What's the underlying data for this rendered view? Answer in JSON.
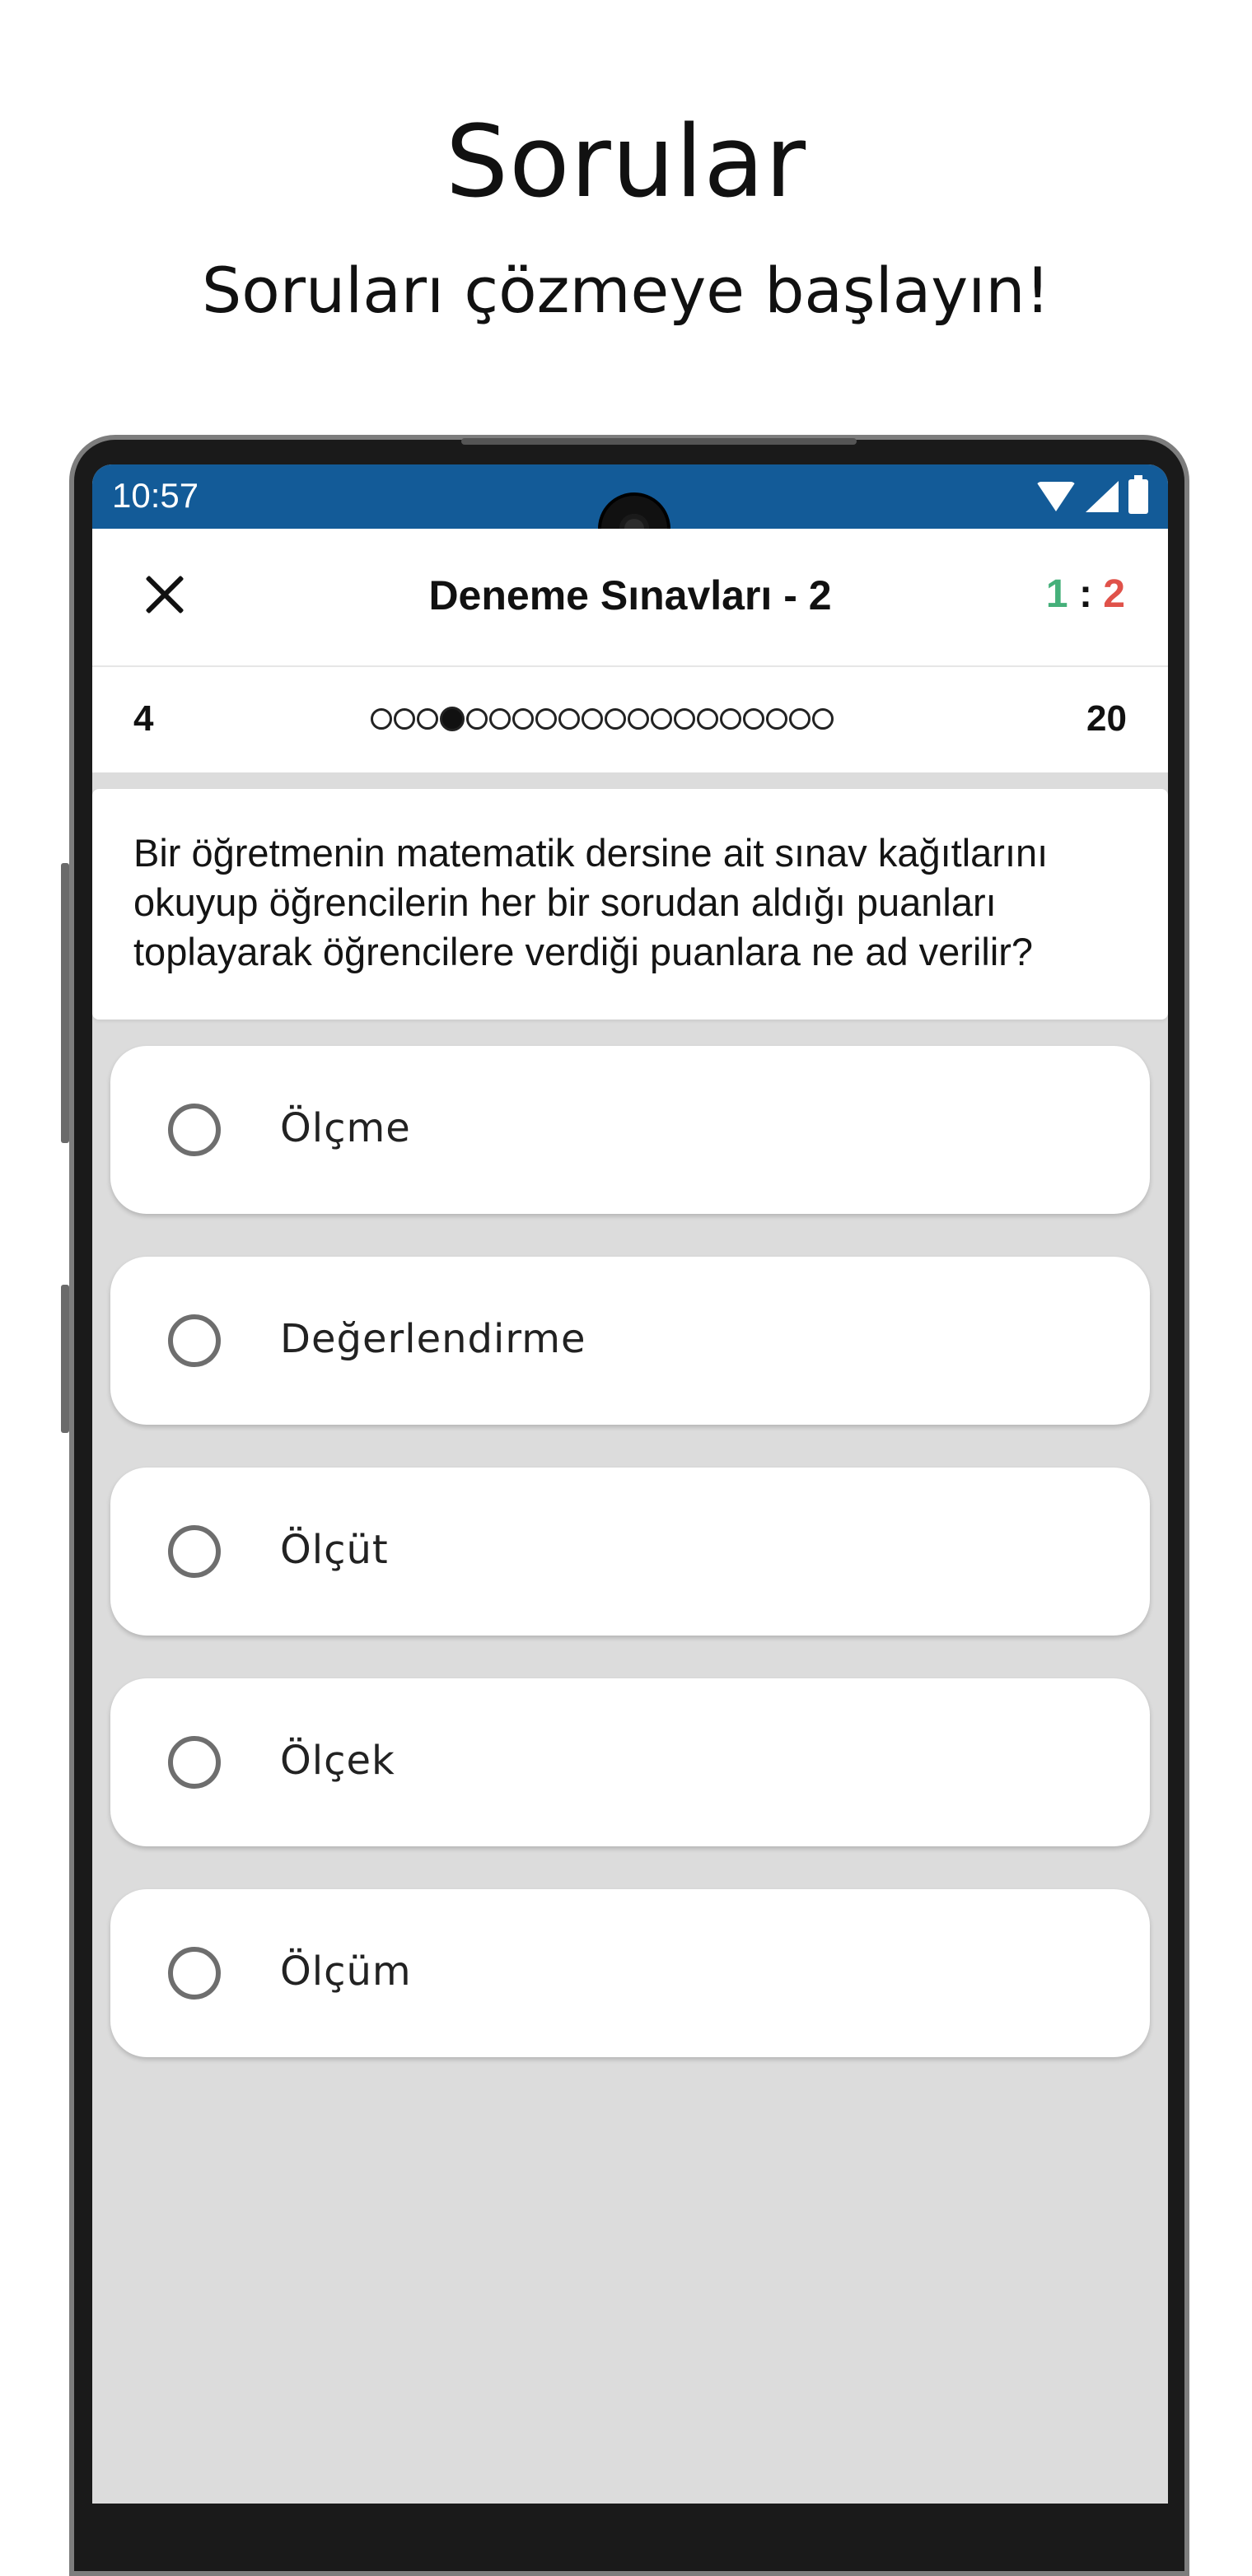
{
  "promo": {
    "title": "Sorular",
    "subtitle": "Soruları çözmeye başlayın!"
  },
  "status_bar": {
    "time": "10:57",
    "icons": [
      "wifi-icon",
      "signal-icon",
      "battery-icon"
    ],
    "color": "#135b98"
  },
  "app_bar": {
    "close_icon": "close-icon",
    "title": "Deneme Sınavları - 2",
    "score": {
      "correct": "1",
      "separator": ":",
      "wrong": "2"
    },
    "colors": {
      "correct": "#45b07a",
      "wrong": "#e0524a"
    }
  },
  "progress": {
    "current_label": "4",
    "total_label": "20",
    "current_index": 4,
    "total": 20
  },
  "question": {
    "text": "Bir öğretmenin matematik dersine ait sınav kağıtlarını okuyup öğrencilerin her bir sorudan aldığı puanları toplayarak öğrencilere verdiği puanlara ne ad verilir?"
  },
  "options": [
    {
      "label": "Ölçme"
    },
    {
      "label": "Değerlendirme"
    },
    {
      "label": "Ölçüt"
    },
    {
      "label": "Ölçek"
    },
    {
      "label": "Ölçüm"
    }
  ]
}
